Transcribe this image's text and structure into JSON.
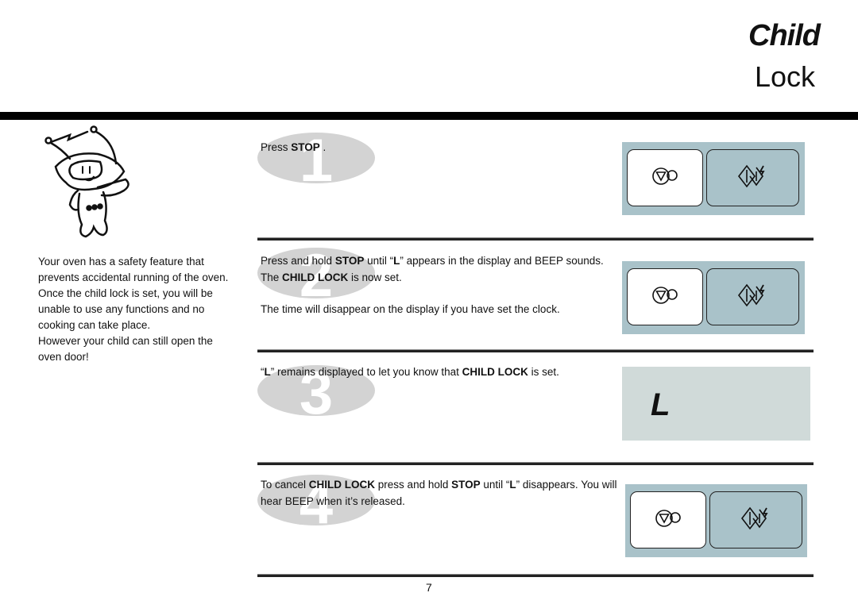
{
  "header": {
    "title_line1": "Child",
    "title_line2": "Lock"
  },
  "intro": {
    "lines": [
      "Your  oven has a safety feature that",
      "prevents accidental running of the oven.",
      "Once the child lock is set, you will be",
      "unable to use any functions and no",
      "cooking can take place.",
      "However your child can still open the",
      "oven door!"
    ]
  },
  "steps": [
    {
      "number": "1",
      "text_parts": [
        [
          "Press ",
          false
        ],
        [
          "STOP",
          true
        ],
        [
          " .",
          false
        ]
      ]
    },
    {
      "number": "2",
      "text_parts": [
        [
          "Press and hold ",
          false
        ],
        [
          "STOP",
          true
        ],
        [
          " until “",
          false
        ],
        [
          "L",
          true
        ],
        [
          "” appears in the display and BEEP sounds.",
          false
        ]
      ],
      "text_parts_2": [
        [
          "The ",
          false
        ],
        [
          "CHILD LOCK",
          true
        ],
        [
          " is now set.",
          false
        ]
      ],
      "note": "The time will disappear on the display if you have set the clock."
    },
    {
      "number": "3",
      "text_parts": [
        [
          "“",
          false
        ],
        [
          "L",
          true
        ],
        [
          "” remains displayed to let you know that ",
          false
        ],
        [
          "CHILD LOCK",
          true
        ],
        [
          " is set.",
          false
        ]
      ]
    },
    {
      "number": "4",
      "text_parts": [
        [
          "To cancel ",
          false
        ],
        [
          "CHILD LOCK",
          true
        ],
        [
          " press and hold ",
          false
        ],
        [
          "STOP",
          true
        ],
        [
          " until “",
          false
        ],
        [
          "L",
          true
        ],
        [
          "” disappears. You will",
          false
        ]
      ],
      "text_parts_2": [
        [
          "hear BEEP when it’s released.",
          false
        ]
      ]
    }
  ],
  "display": {
    "character": "L"
  },
  "colors": {
    "panel": "#a9c2c9",
    "display": "#d0dad9",
    "badge": "#d3d3d3"
  },
  "icons": {
    "stop": "stop-clear-icon",
    "start": "start-quick-icon"
  },
  "footer": {
    "page_number": "7"
  }
}
